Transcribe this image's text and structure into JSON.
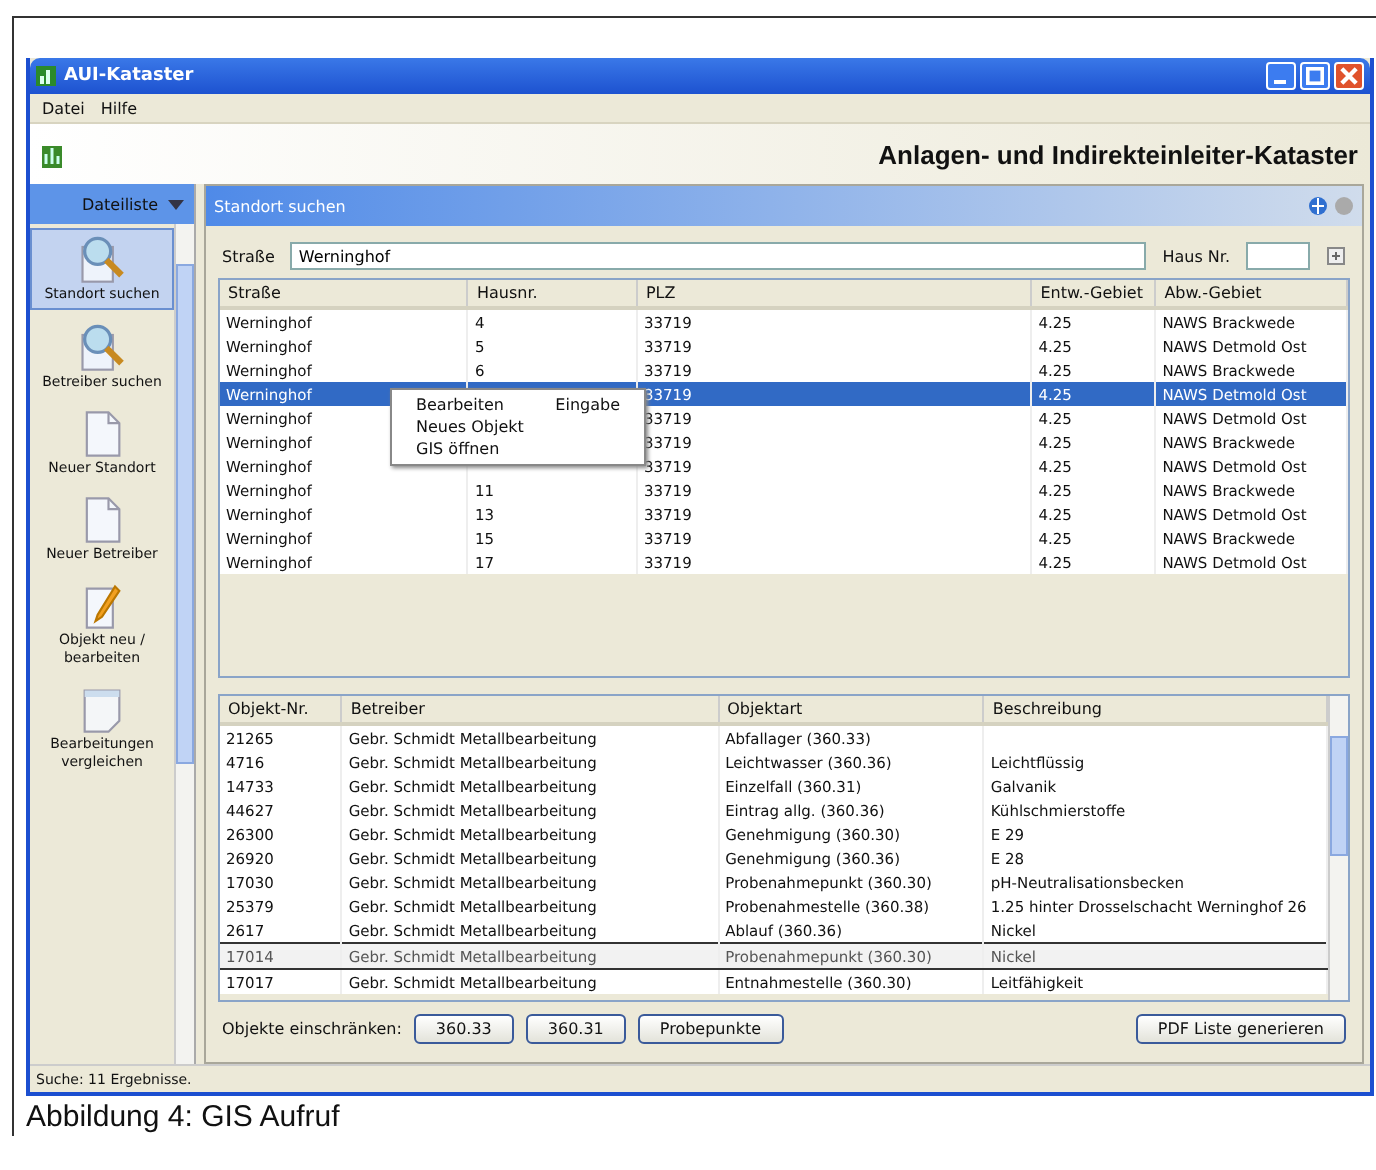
{
  "window": {
    "title": "AUI-Kataster"
  },
  "menu": [
    "Datei",
    "Hilfe"
  ],
  "header": {
    "title": "Anlagen- und Indirekteinleiter-Kataster"
  },
  "sidebar": {
    "title": "Dateiliste",
    "items": [
      {
        "label": "Standort suchen",
        "kind": "search",
        "selected": true
      },
      {
        "label": "Betreiber suchen",
        "kind": "search",
        "selected": false
      },
      {
        "label": "Neuer Standort",
        "kind": "page",
        "selected": false
      },
      {
        "label": "Neuer Betreiber",
        "kind": "page",
        "selected": false
      },
      {
        "label": "Objekt neu / bearbeiten",
        "kind": "edit",
        "selected": false
      },
      {
        "label": "Bearbeitungen vergleichen",
        "kind": "note",
        "selected": false
      }
    ]
  },
  "panel": {
    "title": "Standort suchen"
  },
  "search": {
    "street_label": "Straße",
    "street_value": "Werninghof",
    "house_label": "Haus Nr."
  },
  "upper_table": {
    "columns": [
      "Straße",
      "Hausnr.",
      "PLZ",
      "Entw.-Gebiet",
      "Abw.-Gebiet"
    ],
    "rows": [
      {
        "cells": [
          "Werninghof",
          "4",
          "33719",
          "4.25",
          "NAWS Brackwede"
        ],
        "selected": false
      },
      {
        "cells": [
          "Werninghof",
          "5",
          "33719",
          "4.25",
          "NAWS Detmold Ost"
        ],
        "selected": false
      },
      {
        "cells": [
          "Werninghof",
          "6",
          "33719",
          "4.25",
          "NAWS Brackwede"
        ],
        "selected": false
      },
      {
        "cells": [
          "Werninghof",
          "",
          "33719",
          "4.25",
          "NAWS Detmold Ost"
        ],
        "selected": true
      },
      {
        "cells": [
          "Werninghof",
          "",
          "33719",
          "4.25",
          "NAWS Detmold Ost"
        ],
        "selected": false
      },
      {
        "cells": [
          "Werninghof",
          "",
          "33719",
          "4.25",
          "NAWS Brackwede"
        ],
        "selected": false
      },
      {
        "cells": [
          "Werninghof",
          "",
          "33719",
          "4.25",
          "NAWS Detmold Ost"
        ],
        "selected": false
      },
      {
        "cells": [
          "Werninghof",
          "11",
          "33719",
          "4.25",
          "NAWS Brackwede"
        ],
        "selected": false
      },
      {
        "cells": [
          "Werninghof",
          "13",
          "33719",
          "4.25",
          "NAWS Detmold Ost"
        ],
        "selected": false
      },
      {
        "cells": [
          "Werninghof",
          "15",
          "33719",
          "4.25",
          "NAWS Brackwede"
        ],
        "selected": false
      },
      {
        "cells": [
          "Werninghof",
          "17",
          "33719",
          "4.25",
          "NAWS Detmold Ost"
        ],
        "selected": false
      }
    ]
  },
  "context_menu": [
    {
      "label": "Bearbeiten",
      "shortcut": "Eingabe"
    },
    {
      "label": "Neues Objekt"
    },
    {
      "label": "GIS öffnen"
    }
  ],
  "lower_table": {
    "columns": [
      "Objekt-Nr.",
      "Betreiber",
      "Objektart",
      "Beschreibung"
    ],
    "rows": [
      {
        "cells": [
          "21265",
          "Gebr. Schmidt Metallbearbeitung",
          "Abfallager (360.33)",
          ""
        ],
        "deleted": false
      },
      {
        "cells": [
          "4716",
          "Gebr. Schmidt Metallbearbeitung",
          "Leichtwasser (360.36)",
          "Leichtflüssig"
        ],
        "deleted": false
      },
      {
        "cells": [
          "14733",
          "Gebr. Schmidt Metallbearbeitung",
          "Einzelfall (360.31)",
          "Galvanik"
        ],
        "deleted": false
      },
      {
        "cells": [
          "44627",
          "Gebr. Schmidt Metallbearbeitung",
          "Eintrag allg. (360.36)",
          "Kühlschmierstoffe"
        ],
        "deleted": false
      },
      {
        "cells": [
          "26300",
          "Gebr. Schmidt Metallbearbeitung",
          "Genehmigung (360.30)",
          "E 29"
        ],
        "deleted": false
      },
      {
        "cells": [
          "26920",
          "Gebr. Schmidt Metallbearbeitung",
          "Genehmigung (360.36)",
          "E 28"
        ],
        "deleted": false
      },
      {
        "cells": [
          "17030",
          "Gebr. Schmidt Metallbearbeitung",
          "Probenahmepunkt (360.30)",
          "pH-Neutralisationsbecken"
        ],
        "deleted": false
      },
      {
        "cells": [
          "25379",
          "Gebr. Schmidt Metallbearbeitung",
          "Probenahmestelle (360.38)",
          "1.25 hinter Drosselschacht Werninghof 26"
        ],
        "deleted": false
      },
      {
        "cells": [
          "2617",
          "Gebr. Schmidt Metallbearbeitung",
          "Ablauf (360.36)",
          "Nickel"
        ],
        "deleted": false
      },
      {
        "cells": [
          "17014",
          "Gebr. Schmidt Metallbearbeitung",
          "Probenahmepunkt (360.30)",
          "Nickel"
        ],
        "deleted": true
      },
      {
        "cells": [
          "17017",
          "Gebr. Schmidt Metallbearbeitung",
          "Entnahmestelle (360.30)",
          "Leitfähigkeit"
        ],
        "deleted": false
      }
    ]
  },
  "filter": {
    "label": "Objekte einschränken:",
    "buttons": [
      "360.33",
      "360.31",
      "Probepunkte"
    ]
  },
  "pdf_button": "PDF Liste generieren",
  "status_bar": "Suche: 11 Ergebnisse.",
  "caption": "Abbildung 4: GIS Aufruf"
}
